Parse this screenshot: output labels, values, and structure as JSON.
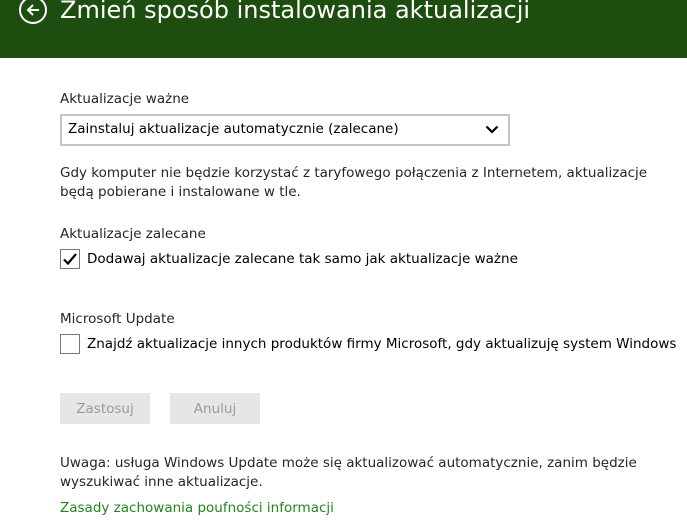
{
  "header": {
    "title": "Zmień sposób instalowania aktualizacji",
    "background_color": "#1e4d10"
  },
  "important_updates": {
    "label": "Aktualizacje ważne",
    "selected": "Zainstaluj aktualizacje automatycznie (zalecane)",
    "description": "Gdy komputer nie będzie korzystać z taryfowego połączenia z Internetem, aktualizacje będą pobierane i instalowane w tle."
  },
  "recommended_updates": {
    "label": "Aktualizacje zalecane",
    "checkbox_label": "Dodawaj aktualizacje zalecane tak samo jak aktualizacje ważne",
    "checked": true
  },
  "microsoft_update": {
    "label": "Microsoft Update",
    "checkbox_label": "Znajdź aktualizacje innych produktów firmy Microsoft, gdy aktualizuję system Windows",
    "checked": false
  },
  "buttons": {
    "apply": "Zastosuj",
    "cancel": "Anuluj"
  },
  "note": "Uwaga: usługa Windows Update może się aktualizować automatycznie, zanim będzie wyszukiwać inne aktualizacje.",
  "privacy_link": "Zasady zachowania poufności informacji",
  "colors": {
    "header": "#1e4d10",
    "link": "#21841d",
    "disabled_button_bg": "#e6e6e6",
    "disabled_button_text": "#9a9a9a"
  },
  "icons": {
    "back": "back-arrow-circle-icon",
    "dropdown": "chevron-down-icon",
    "checkmark": "checkmark-icon"
  }
}
